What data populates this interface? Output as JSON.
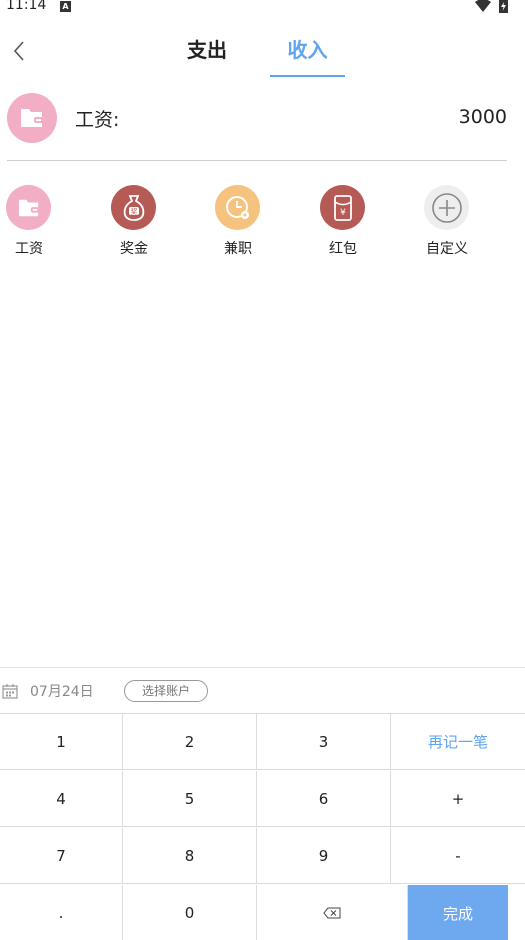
{
  "status_bar": {
    "time": "11:14",
    "notification_badge": "A"
  },
  "header": {
    "tabs": [
      {
        "label": "支出",
        "active": false
      },
      {
        "label": "收入",
        "active": true
      }
    ],
    "accent_color": "#5fa4f0"
  },
  "selected": {
    "label": "工资:",
    "amount": "3000",
    "icon": "wallet-icon",
    "color": "#f2aec4"
  },
  "categories": [
    {
      "label": "工资",
      "icon": "wallet-icon",
      "color": "#f2aec4"
    },
    {
      "label": "奖金",
      "icon": "money-bag-icon",
      "color": "#b55a55",
      "glyph": "奖"
    },
    {
      "label": "兼职",
      "icon": "clock-icon",
      "color": "#f5c37d"
    },
    {
      "label": "红包",
      "icon": "red-envelope-icon",
      "color": "#b55a55",
      "glyph": "¥"
    },
    {
      "label": "自定义",
      "icon": "plus-circle-icon",
      "color": "#eeeeee"
    }
  ],
  "input_bar": {
    "date": "07月24日",
    "account_button": "选择账户"
  },
  "keypad": {
    "keys": [
      [
        "1",
        "2",
        "3",
        "再记一笔"
      ],
      [
        "4",
        "5",
        "6",
        "+"
      ],
      [
        "7",
        "8",
        "9",
        "-"
      ],
      [
        ".",
        "0",
        "",
        "完成"
      ]
    ],
    "done_color": "#6ea8ee"
  }
}
